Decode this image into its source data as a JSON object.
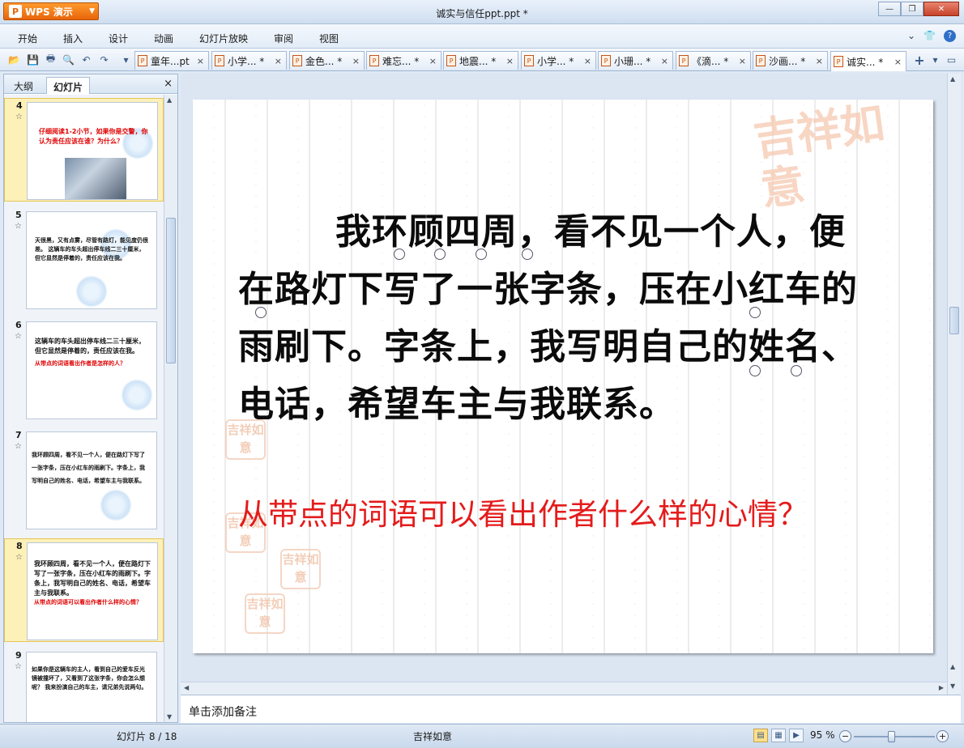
{
  "app": {
    "name": "WPS 演示",
    "logo_glyph": "P",
    "doc_title": "诚实与信任ppt.ppt *"
  },
  "menu": {
    "items": [
      "开始",
      "插入",
      "设计",
      "动画",
      "幻灯片放映",
      "审阅",
      "视图"
    ]
  },
  "tabs": [
    {
      "label": "童年...pt",
      "close": "×"
    },
    {
      "label": "小学... *",
      "close": "×"
    },
    {
      "label": "金色... *",
      "close": "×"
    },
    {
      "label": "难忘... *",
      "close": "×"
    },
    {
      "label": "地震... *",
      "close": "×"
    },
    {
      "label": "小学... *",
      "close": "×"
    },
    {
      "label": "小珊... *",
      "close": "×"
    },
    {
      "label": "《滴... *",
      "close": "×"
    },
    {
      "label": "沙画... *",
      "close": "×"
    },
    {
      "label": "诚实... *",
      "close": "×"
    }
  ],
  "panel": {
    "tab_outline": "大纲",
    "tab_slides": "幻灯片",
    "close": "×"
  },
  "thumbs": [
    {
      "num": "4",
      "text": "仔细阅读1-2小节，如果你是交警，你认为责任应该在谁？为什么？",
      "red": ""
    },
    {
      "num": "5",
      "text": "天很黑，又有点雾，尽管有路灯，能见度仍很差。 这辆车的车头超出停车线二三十厘米，但它显然是停着的，责任应该在我。",
      "red": ""
    },
    {
      "num": "6",
      "text": "这辆车的车头超出停车线二三十厘米，但它显然是停着的，责任应该在我。",
      "red": "从带点的词语看出作者是怎样的人？"
    },
    {
      "num": "7",
      "text": "我环顾四周，看不见一个人，便在路灯下写了一张字条，压在小红车的雨刷下。字条上，我写明自己的姓名、电话，希望车主与我联系。",
      "red": ""
    },
    {
      "num": "8",
      "text": "我环顾四周，看不见一个人，便在路灯下写了一张字条，压在小红车的雨刷下。字条上，我写明自己的姓名、电话，希望车主与我联系。",
      "red": "从带点的词语可以看出作者什么样的心情？"
    },
    {
      "num": "9",
      "text": "如果你是这辆车的主人，看到自己的爱车反光镜被撞坏了，又看到了这张字条，你会怎么想呢？ 我来扮演自己的车主，请兄弟先说两句。",
      "red": ""
    }
  ],
  "slide": {
    "main_text": "我环顾四周，看不见一个人，便在路灯下写了一张字条，压在小红车的雨刷下。字条上，我写明自己的姓名、电话，希望车主与我联系。",
    "question": "从带点的词语可以看出作者什么样的心情？",
    "watermark": "吉祥如意",
    "stamp": "吉祥如意"
  },
  "notes": {
    "placeholder": "单击添加备注"
  },
  "status": {
    "slide_counter": "幻灯片 8 / 18",
    "theme": "吉祥如意",
    "zoom": "95 %"
  },
  "colors": {
    "accent_orange": "#e8650a",
    "question_red": "#e41b1b",
    "selected_thumb": "#fdf1b8"
  }
}
